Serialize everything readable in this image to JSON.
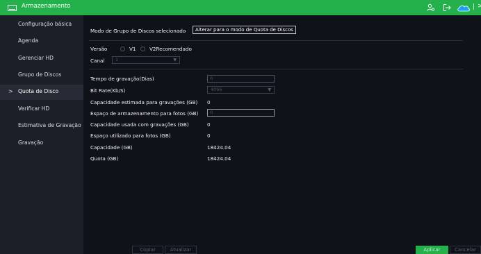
{
  "header": {
    "title": "Armazenamento",
    "icons": [
      "storage-icon",
      "user-icon",
      "logout-icon",
      "cloud-icon",
      "more-icon"
    ],
    "separator": "|",
    "more": ">"
  },
  "sidebar": {
    "items": [
      {
        "label": "Configuração básica",
        "active": false
      },
      {
        "label": "Agenda",
        "active": false
      },
      {
        "label": "Gerenciar HD",
        "active": false
      },
      {
        "label": "Grupo de Discos",
        "active": false
      },
      {
        "label": "Quota de Disco",
        "active": true
      },
      {
        "label": "Verificar HD",
        "active": false
      },
      {
        "label": "Estimativa de Gravação",
        "active": false
      },
      {
        "label": "Gravação",
        "active": false
      }
    ],
    "active_marker": ">"
  },
  "mode": {
    "label": "Modo de Grupo de Discos selecionado",
    "switch_button": "Alterar para o modo de Quota de Discos"
  },
  "version": {
    "label": "Versão",
    "options": [
      "V1",
      "V2Recomendado"
    ]
  },
  "channel": {
    "label": "Canal",
    "value": "1"
  },
  "fields": {
    "record_days_label": "Tempo de gravação(Dias)",
    "record_days_value": "0",
    "bitrate_label": "Bit Rate(Kb/S)",
    "bitrate_value": "4096",
    "est_capacity_label": "Capacidade estimada para gravações (GB)",
    "est_capacity_value": "0",
    "photo_space_label": "Espaço de armazenamento para fotos (GB)",
    "photo_space_value": "0",
    "used_recordings_label": "Capacidade usada com gravações (GB)",
    "used_recordings_value": "0",
    "used_photos_label": "Espaço utilizado para fotos (GB)",
    "used_photos_value": "0",
    "capacity_label": "Capacidade (GB)",
    "capacity_value": "18424.04",
    "quota_label": "Quota (GB)",
    "quota_value": "18424.04"
  },
  "buttons": {
    "copy": "Copiar",
    "refresh": "Atualizar",
    "apply": "Aplicar",
    "cancel": "Cancelar"
  },
  "colors": {
    "accent": "#24b04a",
    "background": "#0f1218",
    "sidebar": "#1b1f27"
  }
}
